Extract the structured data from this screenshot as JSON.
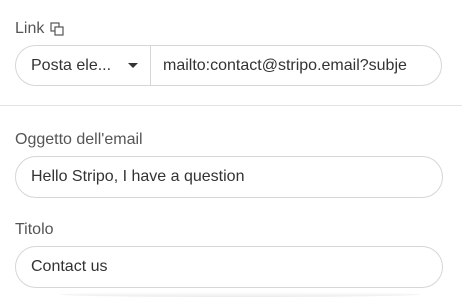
{
  "link": {
    "label": "Link",
    "icon": "copy-icon",
    "type_select": {
      "selected": "Posta ele..."
    },
    "url": {
      "value": "mailto:contact@stripo.email?subje"
    }
  },
  "subject": {
    "label": "Oggetto dell'email",
    "value": "Hello Stripo, I have a question"
  },
  "title": {
    "label": "Titolo",
    "value": "Contact us"
  },
  "colors": {
    "border": "#d6d6d6",
    "text": "#333333",
    "label": "#555555",
    "divider": "#e3e3e3"
  }
}
